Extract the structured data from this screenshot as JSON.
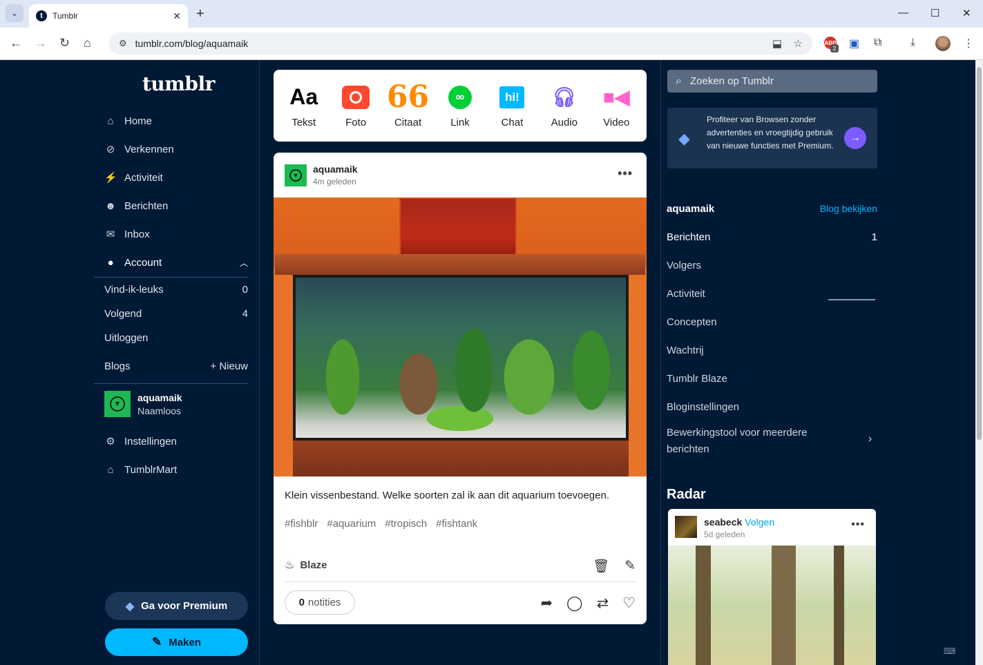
{
  "browser": {
    "tab_title": "Tumblr",
    "url": "tumblr.com/blog/aquamaik",
    "extension_badge": "2"
  },
  "sidebar": {
    "logo": "tumblr",
    "nav": [
      {
        "label": "Home",
        "icon": "home-icon"
      },
      {
        "label": "Verkennen",
        "icon": "compass-icon"
      },
      {
        "label": "Activiteit",
        "icon": "lightning-icon"
      },
      {
        "label": "Berichten",
        "icon": "smiley-icon"
      },
      {
        "label": "Inbox",
        "icon": "envelope-icon"
      },
      {
        "label": "Account",
        "icon": "user-icon"
      }
    ],
    "account_sub": [
      {
        "label": "Vind-ik-leuks",
        "count": "0"
      },
      {
        "label": "Volgend",
        "count": "4"
      },
      {
        "label": "Uitloggen",
        "count": ""
      }
    ],
    "blogs_label": "Blogs",
    "new_blog_label": "+ Nieuw",
    "blog": {
      "name": "aquamaik",
      "title": "Naamloos"
    },
    "settings_label": "Instellingen",
    "mart_label": "TumblrMart",
    "premium_label": "Ga voor Premium",
    "make_label": "Maken"
  },
  "composer": {
    "items": [
      {
        "label": "Tekst",
        "glyph": "Aa"
      },
      {
        "label": "Foto"
      },
      {
        "label": "Citaat",
        "glyph": "66"
      },
      {
        "label": "Link"
      },
      {
        "label": "Chat",
        "glyph": "hi!"
      },
      {
        "label": "Audio"
      },
      {
        "label": "Video"
      }
    ]
  },
  "post": {
    "blog_name": "aquamaik",
    "time": "4m geleden",
    "body": "Klein vissenbestand. Welke soorten zal ik aan dit aquarium toevoegen.",
    "tags": [
      "#fishblr",
      "#aquarium",
      "#tropisch",
      "#fishtank"
    ],
    "blaze_label": "Blaze",
    "notes_count": "0",
    "notes_label": "notities"
  },
  "right": {
    "search_placeholder": "Zoeken op Tumblr",
    "promo_text": "Profiteer van Browsen zonder advertenties en vroegtijdig gebruik van nieuwe functies met Premium.",
    "blog_name": "aquamaik",
    "view_blog_label": "Blog bekijken",
    "items": [
      {
        "label": "Berichten",
        "count": "1"
      },
      {
        "label": "Volgers",
        "count": ""
      },
      {
        "label": "Activiteit",
        "count": ""
      },
      {
        "label": "Concepten",
        "count": ""
      },
      {
        "label": "Wachtrij",
        "count": ""
      },
      {
        "label": "Tumblr Blaze",
        "count": ""
      },
      {
        "label": "Bloginstellingen",
        "count": ""
      }
    ],
    "multi_edit_label": "Bewerkingstool voor meerdere berichten",
    "radar_title": "Radar",
    "radar_post": {
      "blog_name": "seabeck",
      "follow_label": "Volgen",
      "time": "5d geleden"
    }
  },
  "colors": {
    "background": "#001935",
    "accent_blue": "#00b8ff",
    "premium_purple": "#7c5cff",
    "blog_green": "#1db954"
  }
}
